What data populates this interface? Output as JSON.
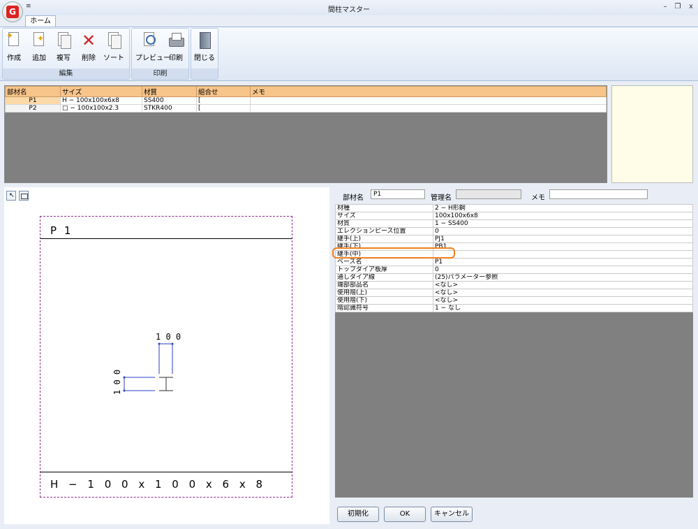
{
  "window": {
    "title": "間柱マスター",
    "qat": "≡"
  },
  "ribbon": {
    "tab": "ホーム",
    "groups": {
      "edit": "編集",
      "print": "印刷"
    },
    "buttons": {
      "create": "作成",
      "add": "追加",
      "copy": "複写",
      "delete": "削除",
      "sort": "ソート",
      "preview": "プレビュー",
      "print": "印刷",
      "close": "閉じる"
    }
  },
  "grid": {
    "headers": [
      "部材名",
      "サイズ",
      "材質",
      "組合せ",
      "メモ"
    ],
    "rows": [
      [
        "P1",
        "H − 100x100x6x8",
        "SS400",
        "[",
        ""
      ],
      [
        "P2",
        "□ − 100x100x2.3",
        "STKR400",
        "[",
        ""
      ]
    ]
  },
  "drawing": {
    "title": "P 1",
    "size": "H − 1 0 0 x 1 0 0 x 6 x 8",
    "dim_w": "1 0 0",
    "dim_h": "1 0 0"
  },
  "form": {
    "name_label": "部材名",
    "name_value": "P1",
    "mgmt_label": "管理名",
    "mgmt_value": "",
    "memo_label": "メモ",
    "memo_value": ""
  },
  "props": [
    [
      "材種",
      "2 − H形鋼"
    ],
    [
      "サイズ",
      "100x100x6x8"
    ],
    [
      "材質",
      "1 − SS400"
    ],
    [
      "エレクションピース位置",
      "0"
    ],
    [
      "継手(上)",
      "PJ1"
    ],
    [
      "継手(下)",
      "PB1"
    ],
    [
      "継手(中)",
      ""
    ],
    [
      "ベース名",
      "P1"
    ],
    [
      "トップダイア板厚",
      "0"
    ],
    [
      "通しダイア線",
      "(25)パラメーター参照"
    ],
    [
      "端部部品名",
      "<なし>"
    ],
    [
      "使用階(上)",
      "<なし>"
    ],
    [
      "使用階(下)",
      "<なし>"
    ],
    [
      "階認識符号",
      "1 − なし"
    ]
  ],
  "buttons": {
    "init": "初期化",
    "ok": "OK",
    "cancel": "キャンセル"
  },
  "colors": {
    "header": "#f7c48a",
    "highlight": "#f07e1c",
    "frame": "#8a2b8a",
    "dim": "#2a3fc9"
  }
}
